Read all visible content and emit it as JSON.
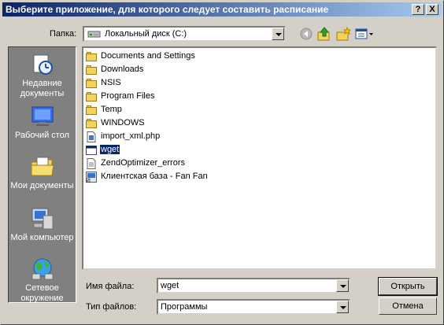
{
  "window": {
    "title": "Выберите приложение, для которого следует составить расписание",
    "help_button": "?",
    "close_button": "X"
  },
  "location": {
    "label": "Папка:",
    "value": "Локальный диск (C:)"
  },
  "toolbar": {
    "icons": [
      "back-icon",
      "up-folder-icon",
      "new-folder-icon",
      "view-menu-icon"
    ]
  },
  "places": [
    {
      "label": "Недавние документы",
      "icon": "recent-documents-icon"
    },
    {
      "label": "Рабочий стол",
      "icon": "desktop-icon"
    },
    {
      "label": "Мои документы",
      "icon": "my-documents-icon"
    },
    {
      "label": "Мой компьютер",
      "icon": "my-computer-icon"
    },
    {
      "label": "Сетевое окружение",
      "icon": "network-places-icon"
    }
  ],
  "files": [
    {
      "name": "Documents and Settings",
      "type": "folder"
    },
    {
      "name": "Downloads",
      "type": "folder"
    },
    {
      "name": "NSIS",
      "type": "folder"
    },
    {
      "name": "Program Files",
      "type": "folder"
    },
    {
      "name": "Temp",
      "type": "folder"
    },
    {
      "name": "WINDOWS",
      "type": "folder"
    },
    {
      "name": "import_xml.php",
      "type": "php-file"
    },
    {
      "name": "wget",
      "type": "executable",
      "selected": true
    },
    {
      "name": "ZendOptimizer_errors",
      "type": "text-file"
    },
    {
      "name": "Клиентская база - Fan Fan",
      "type": "shortcut"
    }
  ],
  "filename": {
    "label": "Имя файла:",
    "value": "wget"
  },
  "filetype": {
    "label": "Тип файлов:",
    "value": "Программы"
  },
  "buttons": {
    "open": "Открыть",
    "cancel": "Отмена"
  },
  "colors": {
    "title_bar_start": "#0a246a",
    "title_bar_end": "#a6caf0",
    "dialog_face": "#d4d0c8",
    "places_bar": "#808080",
    "selection": "#0a246a"
  }
}
